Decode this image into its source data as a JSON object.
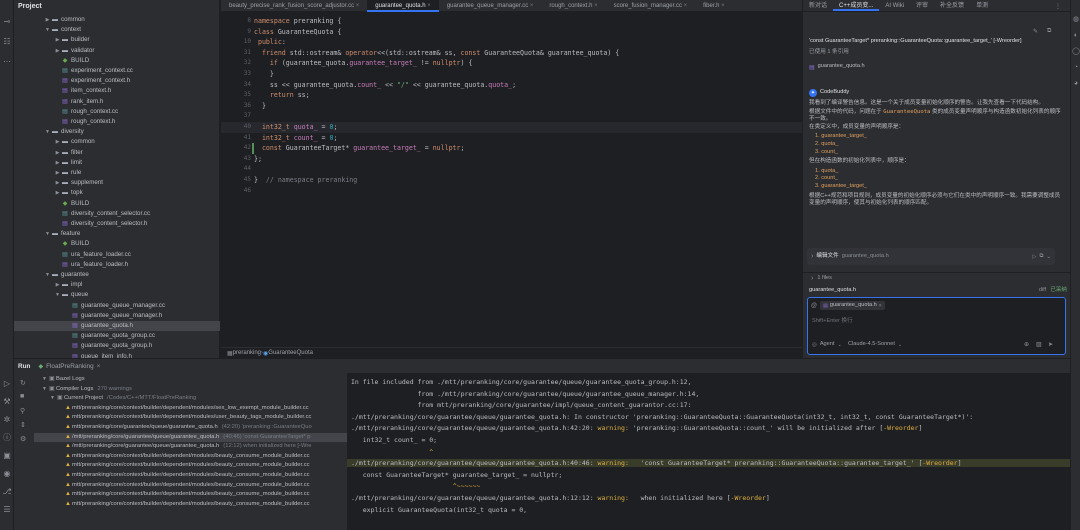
{
  "project_panel": {
    "title": "Project",
    "rows": [
      {
        "indent": 3,
        "kind": "folder",
        "chev": "▶",
        "label": "common"
      },
      {
        "indent": 3,
        "kind": "folder",
        "chev": "▼",
        "label": "context"
      },
      {
        "indent": 4,
        "kind": "folder",
        "chev": "▶",
        "label": "builder"
      },
      {
        "indent": 4,
        "kind": "folder",
        "chev": "▶",
        "label": "validator"
      },
      {
        "indent": 4,
        "kind": "build",
        "chev": "",
        "label": "BUILD"
      },
      {
        "indent": 4,
        "kind": "cc",
        "chev": "",
        "label": "experiment_context.cc"
      },
      {
        "indent": 4,
        "kind": "h",
        "chev": "",
        "label": "experiment_context.h"
      },
      {
        "indent": 4,
        "kind": "h",
        "chev": "",
        "label": "item_context.h"
      },
      {
        "indent": 4,
        "kind": "h",
        "chev": "",
        "label": "rank_item.h"
      },
      {
        "indent": 4,
        "kind": "cc",
        "chev": "",
        "label": "rough_context.cc"
      },
      {
        "indent": 4,
        "kind": "h",
        "chev": "",
        "label": "rough_context.h"
      },
      {
        "indent": 3,
        "kind": "folder",
        "chev": "▼",
        "label": "diversity"
      },
      {
        "indent": 4,
        "kind": "folder",
        "chev": "▶",
        "label": "common"
      },
      {
        "indent": 4,
        "kind": "folder",
        "chev": "▶",
        "label": "filter"
      },
      {
        "indent": 4,
        "kind": "folder",
        "chev": "▶",
        "label": "limit"
      },
      {
        "indent": 4,
        "kind": "folder",
        "chev": "▶",
        "label": "rule"
      },
      {
        "indent": 4,
        "kind": "folder",
        "chev": "▶",
        "label": "supplement"
      },
      {
        "indent": 4,
        "kind": "folder",
        "chev": "▶",
        "label": "topk"
      },
      {
        "indent": 4,
        "kind": "build",
        "chev": "",
        "label": "BUILD"
      },
      {
        "indent": 4,
        "kind": "cc",
        "chev": "",
        "label": "diversity_content_selector.cc"
      },
      {
        "indent": 4,
        "kind": "h",
        "chev": "",
        "label": "diversity_content_selector.h"
      },
      {
        "indent": 3,
        "kind": "folder",
        "chev": "▼",
        "label": "feature"
      },
      {
        "indent": 4,
        "kind": "build",
        "chev": "",
        "label": "BUILD"
      },
      {
        "indent": 4,
        "kind": "cc",
        "chev": "",
        "label": "ura_feature_loader.cc"
      },
      {
        "indent": 4,
        "kind": "h",
        "chev": "",
        "label": "ura_feature_loader.h"
      },
      {
        "indent": 3,
        "kind": "folder",
        "chev": "▼",
        "label": "guarantee"
      },
      {
        "indent": 4,
        "kind": "folder",
        "chev": "▶",
        "label": "impl"
      },
      {
        "indent": 4,
        "kind": "folder",
        "chev": "▼",
        "label": "queue"
      },
      {
        "indent": 5,
        "kind": "cc",
        "chev": "",
        "label": "guarantee_queue_manager.cc"
      },
      {
        "indent": 5,
        "kind": "h",
        "chev": "",
        "label": "guarantee_queue_manager.h"
      },
      {
        "indent": 5,
        "kind": "h",
        "chev": "",
        "label": "guarantee_quota.h",
        "selected": true
      },
      {
        "indent": 5,
        "kind": "cc",
        "chev": "",
        "label": "guarantee_quota_group.cc"
      },
      {
        "indent": 5,
        "kind": "h",
        "chev": "",
        "label": "guarantee_quota_group.h"
      },
      {
        "indent": 5,
        "kind": "h",
        "chev": "",
        "label": "queue_item_info.h"
      }
    ]
  },
  "editor": {
    "tabs": [
      {
        "label": "beauty_precise_rank_fusion_score_adjustor.cc",
        "active": false
      },
      {
        "label": "guarantee_quota.h",
        "active": true
      },
      {
        "label": "guarantee_queue_manager.cc",
        "active": false
      },
      {
        "label": "rough_context.h",
        "active": false
      },
      {
        "label": "score_fusion_manager.cc",
        "active": false
      },
      {
        "label": "fiber.h",
        "active": false
      }
    ],
    "lines": [
      {
        "n": "8",
        "html": "<span class=\"kw\">namespace</span> preranking {"
      },
      {
        "n": "9",
        "html": "<span class=\"kw\">class</span> GuaranteeQuota {"
      },
      {
        "n": "10",
        "html": " <span class=\"kw\">public</span>:"
      },
      {
        "n": "31",
        "html": "  <span class=\"kw\">friend</span> std::ostream&amp; <span class=\"kw\">operator</span>&lt;&lt;(std::ostream&amp; ss, <span class=\"kw\">const</span> GuaranteeQuota&amp; guarantee_quota) {"
      },
      {
        "n": "32",
        "html": "    <span class=\"kw\">if</span> (guarantee_quota.<span class=\"mem\">guarantee_target_</span> != <span class=\"kw\">nullptr</span>) {"
      },
      {
        "n": "33",
        "html": "    }"
      },
      {
        "n": "34",
        "html": "    ss &lt;&lt; guarantee_quota.<span class=\"mem\">count_</span> &lt;&lt; <span class=\"str\">\"/\"</span> &lt;&lt; guarantee_quota.<span class=\"mem\">quota_</span>;"
      },
      {
        "n": "35",
        "html": "    <span class=\"kw\">return</span> ss;"
      },
      {
        "n": "36",
        "html": "  }"
      },
      {
        "n": "37",
        "html": ""
      },
      {
        "n": "40",
        "html": "  <span class=\"kw\">int32_t</span> <span class=\"mem\">quota_</span> = <span class=\"num\">0</span>;"
      },
      {
        "n": "41",
        "html": "  <span class=\"kw\">int32_t</span> <span class=\"mem\">count_</span> = <span class=\"num\">0</span>;"
      },
      {
        "n": "42",
        "html": "  <span class=\"kw\">const</span> GuaranteeTarget* <span class=\"mem\">guarantee_target_</span> = <span class=\"kw\">nullptr</span>;"
      },
      {
        "n": "43",
        "html": "};"
      },
      {
        "n": "44",
        "html": ""
      },
      {
        "n": "45",
        "html": "}  <span class=\"cm\">// namespace preranking</span>"
      },
      {
        "n": "46",
        "html": ""
      }
    ],
    "breadcrumb": [
      "preranking",
      "GuaranteeQuota"
    ]
  },
  "ai_panel": {
    "tabs": [
      {
        "label": "新对话",
        "active": false
      },
      {
        "label": "C++成员变...",
        "active": true
      },
      {
        "label": "AI Wiki",
        "active": false
      },
      {
        "label": "评审",
        "active": false
      },
      {
        "label": "补全反馈",
        "active": false
      },
      {
        "label": "单测",
        "active": false
      }
    ],
    "user_msg": "'const GuaranteeTarget* preranking::GuaranteeQuota::guarantee_target_' [-Wreorder]",
    "used_label": "已使用 1 条引用",
    "ref_file": "guarantee_quota.h",
    "bot_name": "CodeBuddy",
    "p1": "我看到了编译警告信息。这是一个关于成员变量初始化顺序的警告。让我先查看一下代码结构。",
    "p2a": "根据文件中的代码，问题在于 ",
    "p2code": "GuaranteeQuota",
    "p2b": " 类的成员变量声明顺序与构造函数初始化列表的顺序不一致。",
    "p3": "在类定义中，成员变量的声明顺序是：",
    "list1": [
      "1. guarantee_target_",
      "2. quota_",
      "3. count_"
    ],
    "p4": "但在构造函数的初始化列表中，顺序是：",
    "list2": [
      "1. quota_",
      "2. count_",
      "3. guarantee_target_"
    ],
    "p5": "根据C++规范和项目规则，成员变量的初始化顺序必须与它们在类中的声明顺序一致。我需要调整成员变量的声明顺序，使其与初始化列表的顺序匹配。",
    "edit_label": "编辑文件",
    "edit_file": "guarantee_quota.h",
    "files_count": "1 files",
    "changed_file": "guarantee_quota.h",
    "diff_label": "diff",
    "applied_label": "已采纳",
    "chip_file": "guarantee_quota.h",
    "input_placeholder": "Shift+Enter 换行",
    "agent_label": "Agent",
    "model_label": "Claude-4.5-Sonnet"
  },
  "bottom": {
    "tabs": [
      "Run",
      "FloatPreRanking"
    ],
    "tree": [
      {
        "indent": 1,
        "icon": "",
        "label": "Bazel Logs",
        "sel": false
      },
      {
        "indent": 1,
        "icon": "",
        "label": "Compiler Logs",
        "extra": "270 warnings",
        "sel": false
      },
      {
        "indent": 2,
        "icon": "",
        "label": "Current Project",
        "extra": "/Codes/C++/MTT/FloatPreRanking",
        "sel": false
      },
      {
        "indent": 3,
        "icon": "warn",
        "label": "mtt/preranking/core/context/builder/dependent/modules/sex_low_exempt_module_builder.cc",
        "sel": false
      },
      {
        "indent": 3,
        "icon": "warn",
        "label": "mtt/preranking/core/context/builder/dependent/modules/user_beauty_tags_module_builder.cc",
        "sel": false
      },
      {
        "indent": 3,
        "icon": "warn",
        "label": "mtt/preranking/core/guarantee/queue/guarantee_quota.h",
        "extra": "(42:20) 'preranking::GuaranteeQuo",
        "sel": false
      },
      {
        "indent": 3,
        "icon": "warn",
        "label": "/mtt/preranking/core/guarantee/queue/guarantee_quota.h",
        "extra": "(40:46) 'const GuaranteeTarget* p",
        "sel": true
      },
      {
        "indent": 3,
        "icon": "warn",
        "label": "/mtt/preranking/core/guarantee/queue/guarantee_quota.h",
        "extra": "(12:12) when initialized here [-Wre",
        "sel": false
      },
      {
        "indent": 3,
        "icon": "warn",
        "label": "mtt/preranking/core/context/builder/dependent/modules/beauty_consume_module_builder.cc",
        "sel": false
      },
      {
        "indent": 3,
        "icon": "warn",
        "label": "mtt/preranking/core/context/builder/dependent/modules/beauty_consume_module_builder.cc",
        "sel": false
      },
      {
        "indent": 3,
        "icon": "warn",
        "label": "mtt/preranking/core/context/builder/dependent/modules/beauty_consume_module_builder.cc",
        "sel": false
      },
      {
        "indent": 3,
        "icon": "warn",
        "label": "mtt/preranking/core/context/builder/dependent/modules/beauty_consume_module_builder.cc",
        "sel": false
      },
      {
        "indent": 3,
        "icon": "warn",
        "label": "mtt/preranking/core/context/builder/dependent/modules/beauty_consume_module_builder.cc",
        "sel": false
      },
      {
        "indent": 3,
        "icon": "warn",
        "label": "mtt/preranking/core/context/builder/dependent/modules/beauty_consume_module_builder.cc",
        "sel": false
      }
    ],
    "console": [
      {
        "html": "In file included from ./mtt/preranking/core/guarantee/queue/guarantee_quota_group.h:12,",
        "hl": false
      },
      {
        "html": "                 from ./mtt/preranking/core/guarantee/queue/guarantee_queue_manager.h:14,",
        "hl": false
      },
      {
        "html": "                 from mtt/preranking/core/guarantee/impl/queue_content_guarantor.cc:17:",
        "hl": false
      },
      {
        "html": "./mtt/preranking/core/guarantee/queue/guarantee_quota.h: In constructor 'preranking::GuaranteeQuota::GuaranteeQuota(int32_t, int32_t, const GuaranteeTarget*)':",
        "hl": false
      },
      {
        "html": "./mtt/preranking/core/guarantee/queue/guarantee_quota.h:42:20: <span class=\"warn\">warning:</span> 'preranking::GuaranteeQuota::count_' will be initialized after [<span class=\"warn\">-Wreorder</span>]",
        "hl": false
      },
      {
        "html": "   int32_t count_ = 0;",
        "hl": false
      },
      {
        "html": "                    <span class=\"warn\">^</span>",
        "hl": false
      },
      {
        "html": "./mtt/preranking/core/guarantee/queue/guarantee_quota.h:40:46: <span class=\"warn\">warning:</span>   'const GuaranteeTarget* preranking::GuaranteeQuota::guarantee_target_' [<span class=\"warn\">-Wreorder</span>]",
        "hl": true
      },
      {
        "html": "   const GuaranteeTarget* guarantee_target_ = nullptr;",
        "hl": false
      },
      {
        "html": "                          <span class=\"warn\">^~~~~~~</span>",
        "hl": false
      },
      {
        "html": "./mtt/preranking/core/guarantee/queue/guarantee_quota.h:12:12: <span class=\"warn\">warning:</span>   when initialized here [<span class=\"warn\">-Wreorder</span>]",
        "hl": false
      },
      {
        "html": "   explicit GuaranteeQuota(int32_t quota = 0,",
        "hl": false
      }
    ]
  }
}
